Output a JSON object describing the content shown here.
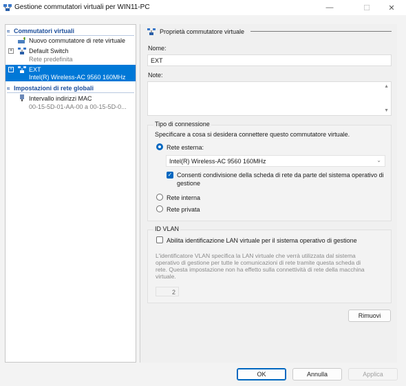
{
  "window": {
    "title": "Gestione commutatori virtuali per WIN11-PC",
    "minimize_glyph": "—",
    "maximize_glyph": "☐",
    "close_glyph": "✕"
  },
  "tree": {
    "virtual_switches_header": "Commutatori virtuali",
    "new_switch": "Nuovo commutatore di rete virtuale",
    "default_switch": "Default Switch",
    "default_switch_sub": "Rete predefinita",
    "ext": "EXT",
    "ext_sub": "Intel(R) Wireless-AC 9560 160MHz",
    "global_header": "Impostazioni di rete globali",
    "mac_range": "Intervallo indirizzi MAC",
    "mac_range_sub": "00-15-5D-01-AA-00 a 00-15-5D-0..."
  },
  "properties": {
    "header": "Proprietà commutatore virtuale",
    "name_label": "Nome:",
    "name_value": "EXT",
    "notes_label": "Note:",
    "notes_value": "",
    "connection_type_label": "Tipo di connessione",
    "connection_desc": "Specificare a cosa si desidera connettere questo commutatore virtuale.",
    "external_label": "Rete esterna:",
    "adapter_selected": "Intel(R) Wireless-AC 9560 160MHz",
    "share_line1": "Consenti condivisione della scheda di rete da parte del sistema operativo di",
    "share_line2": "gestione",
    "internal_label": "Rete interna",
    "private_label": "Rete privata",
    "vlan_label": "ID VLAN",
    "vlan_enable_label": "Abilita identificazione LAN virtuale per il sistema operativo di gestione",
    "vlan_desc_lines": [
      "L'identificatore VLAN specifica la LAN virtuale che verrà utilizzata dal sistema",
      "operativo di gestione per tutte le comunicazioni di rete tramite questa scheda di",
      "rete. Questa impostazione non ha effetto sulla connettività di rete della macchina",
      "virtuale."
    ],
    "vlan_id": "2",
    "remove_button": "Rimuovi"
  },
  "footer": {
    "ok": "OK",
    "cancel": "Annulla",
    "apply": "Applica"
  },
  "colors": {
    "selection": "#0078d7",
    "accent": "#0067c0",
    "header_text": "#1d4f9c"
  }
}
